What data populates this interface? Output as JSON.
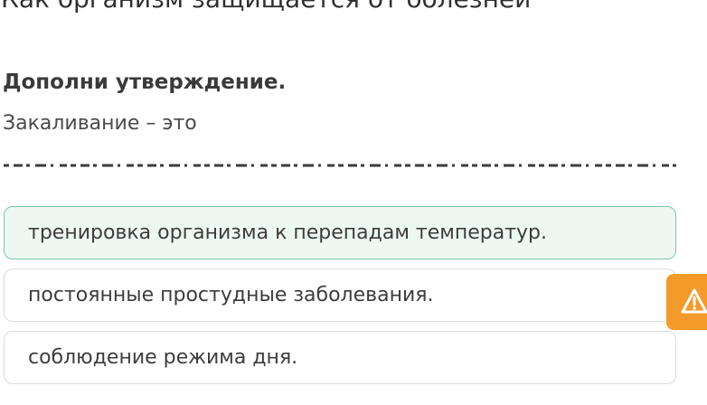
{
  "header": {
    "title": "Как организм защищается от болезней"
  },
  "question": {
    "instruction": "Дополни утверждение.",
    "statement": "Закаливание – это"
  },
  "options": [
    {
      "text": "тренировка организма к перепадам температур.",
      "selected": true
    },
    {
      "text": "постоянные простудные заболевания.",
      "selected": false
    },
    {
      "text": "соблюдение режима дня.",
      "selected": false
    }
  ],
  "colors": {
    "selected_background": "#eef8f3",
    "selected_border": "#79c9a5",
    "report_button": "#f39a2b"
  },
  "icons": {
    "report": "warning-icon"
  }
}
